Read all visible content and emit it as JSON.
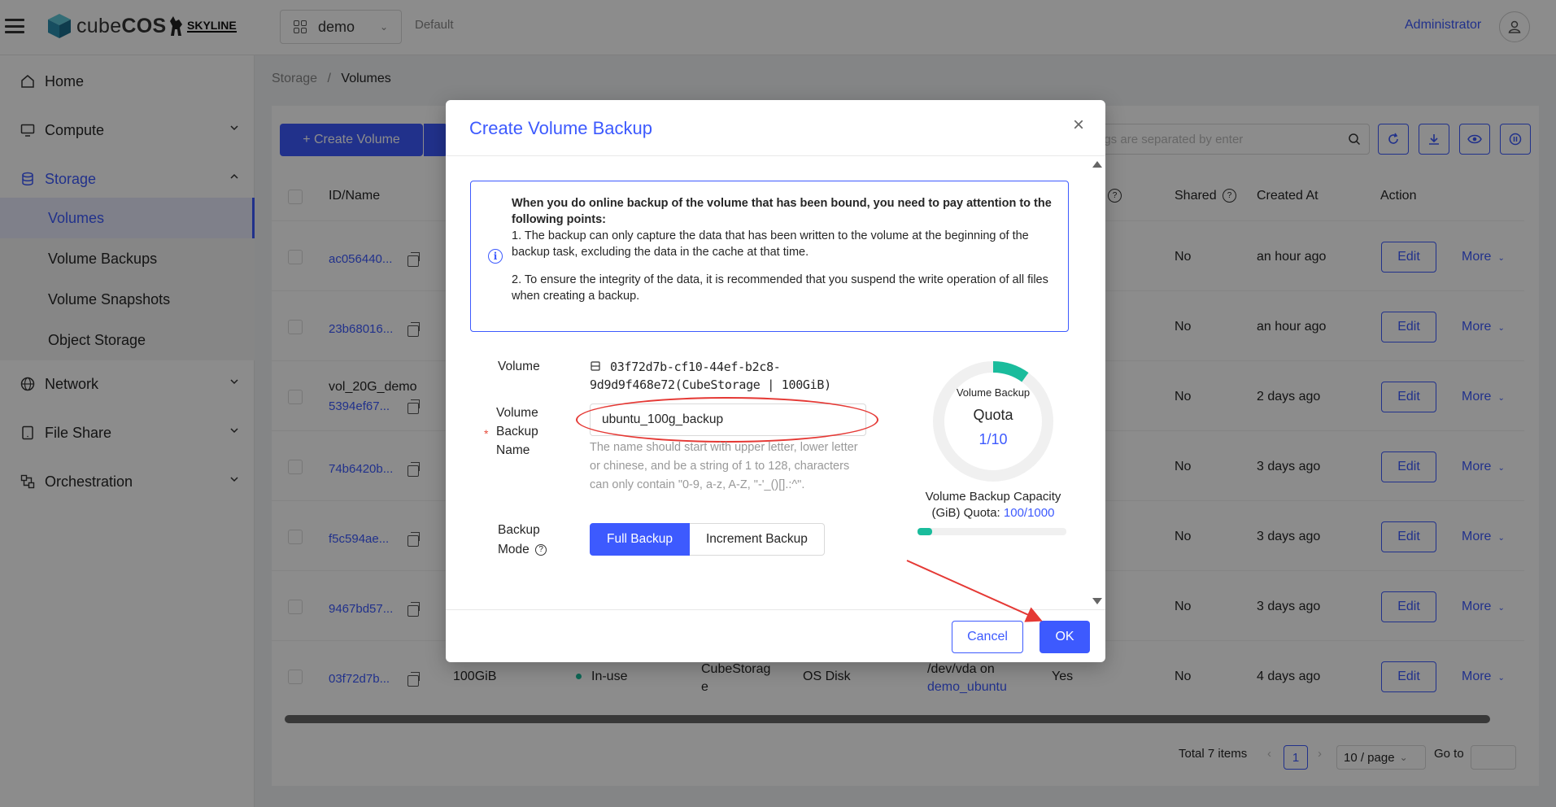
{
  "header": {
    "brand_prefix": "cube",
    "brand_suffix": "COS",
    "partner": "SKYLINE",
    "project": "demo",
    "domain": "Default",
    "user": "Administrator"
  },
  "sidebar": {
    "items": [
      {
        "label": "Home",
        "icon": "home-icon"
      },
      {
        "label": "Compute",
        "icon": "monitor-icon"
      },
      {
        "label": "Storage",
        "icon": "database-icon"
      },
      {
        "label": "Network",
        "icon": "globe-icon"
      },
      {
        "label": "File Share",
        "icon": "tablet-icon"
      },
      {
        "label": "Orchestration",
        "icon": "orchestration-icon"
      }
    ],
    "storage_sub": [
      "Volumes",
      "Volume Backups",
      "Volume Snapshots",
      "Object Storage"
    ]
  },
  "breadcrumb": {
    "parent": "Storage",
    "separator": "/",
    "current": "Volumes"
  },
  "toolbar": {
    "create_label": "+ Create Volume",
    "search_placeholder": "ags are separated by enter"
  },
  "table": {
    "headers": {
      "id_name": "ID/Name",
      "shared": "Shared",
      "created_at": "Created At",
      "action": "Action"
    },
    "rows": [
      {
        "id": "ac056440...",
        "name": "",
        "shared": "No",
        "created": "an hour ago"
      },
      {
        "id": "23b68016...",
        "name": "",
        "shared": "No",
        "created": "an hour ago"
      },
      {
        "id": "5394ef67...",
        "name": "vol_20G_demo",
        "shared": "No",
        "created": "2 days ago"
      },
      {
        "id": "74b6420b...",
        "name": "",
        "shared": "No",
        "created": "3 days ago"
      },
      {
        "id": "f5c594ae...",
        "name": "",
        "shared": "No",
        "created": "3 days ago"
      },
      {
        "id": "9467bd57...",
        "name": "",
        "shared": "No",
        "created": "3 days ago"
      },
      {
        "id": "03f72d7b...",
        "name": "",
        "shared": "No",
        "created": "4 days ago",
        "size": "100GiB",
        "status": "In-use",
        "type_l1": "CubeStorag",
        "type_l2": "e",
        "disk": "OS Disk",
        "attach_l1": "/dev/vda on",
        "attach_l2": "demo_ubuntu",
        "bootable": "Yes"
      }
    ],
    "edit_label": "Edit",
    "more_label": "More"
  },
  "pagination": {
    "total": "Total 7 items",
    "page": "1",
    "page_size": "10 / page",
    "goto": "Go to"
  },
  "modal": {
    "title": "Create Volume Backup",
    "alert": {
      "heading": "When you do online backup of the volume that has been bound, you need to pay attention to the following points:",
      "point1": "1. The backup can only capture the data that has been written to the volume at the beginning of the backup task, excluding the data in the cache at that time.",
      "point2": "2. To ensure the integrity of the data, it is recommended that you suspend the write operation of all files when creating a backup."
    },
    "volume_label": "Volume",
    "volume_value_l1": "03f72d7b-cf10-44ef-b2c8-",
    "volume_value_l2": "9d9d9f468e72(CubeStorage | 100GiB)",
    "name_label_l1": "Volume",
    "name_label_l2": "Backup",
    "name_label_l3": "Name",
    "name_value": "ubuntu_100g_backup",
    "name_hint": "The name should start with upper letter, lower letter or chinese, and be a string of 1 to 128, characters can only contain \"0-9, a-z, A-Z, \"-'_()[].:^\".",
    "mode_label_l1": "Backup",
    "mode_label_l2": "Mode",
    "mode_full": "Full Backup",
    "mode_increment": "Increment Backup",
    "quota_small": "Volume Backup",
    "quota_big": "Quota",
    "quota_count": "1/10",
    "capacity_label": "Volume Backup Capacity (GiB) Quota:",
    "capacity_value": "100/1000",
    "cancel_label": "Cancel",
    "ok_label": "OK"
  },
  "quota": {
    "used": 1,
    "total": 10,
    "capacity_used": 100,
    "capacity_total": 1000
  },
  "colors": {
    "accent": "#3d5afe",
    "success": "#1abc9c",
    "annotation": "#e53935"
  }
}
